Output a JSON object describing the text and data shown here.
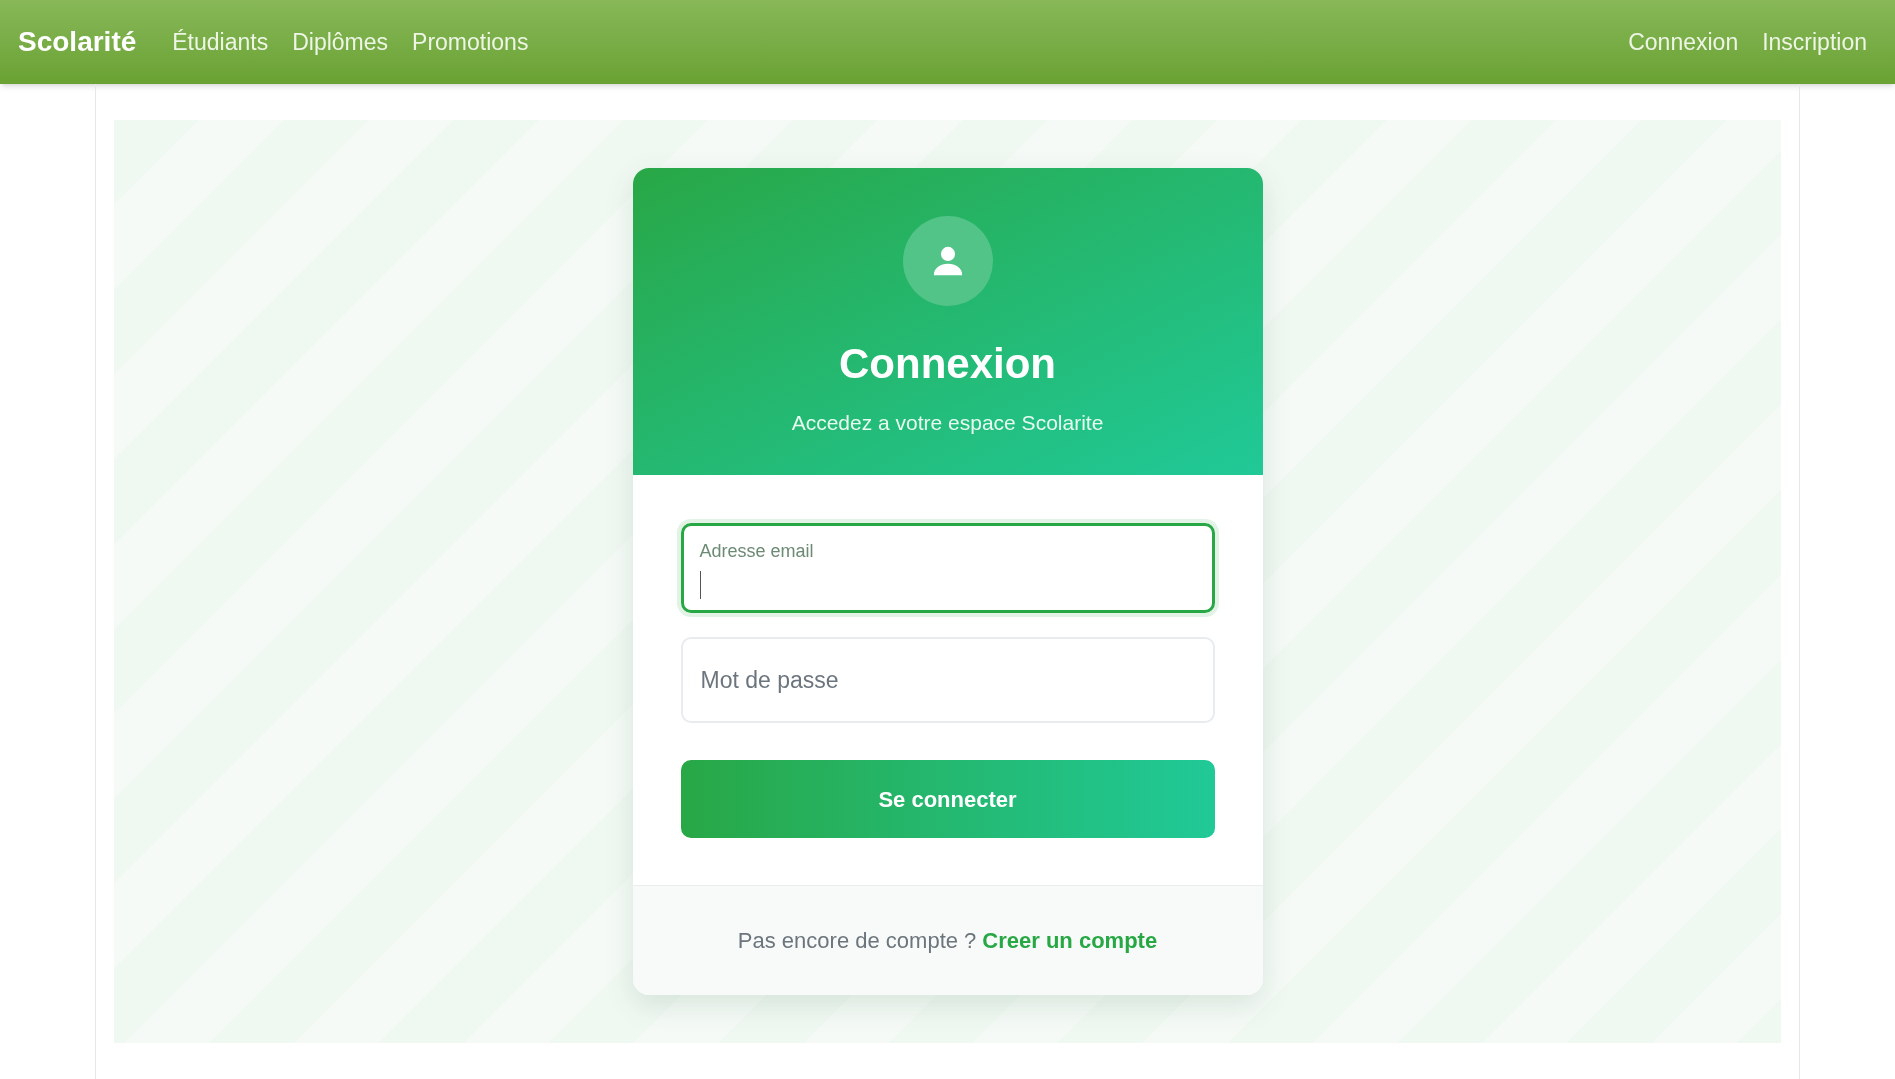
{
  "navbar": {
    "brand": "Scolarité",
    "links": [
      {
        "label": "Étudiants"
      },
      {
        "label": "Diplômes"
      },
      {
        "label": "Promotions"
      }
    ],
    "right_links": [
      {
        "label": "Connexion"
      },
      {
        "label": "Inscription"
      }
    ]
  },
  "login_card": {
    "title": "Connexion",
    "subtitle": "Accedez a votre espace Scolarite",
    "fields": [
      {
        "placeholder": "Adresse email",
        "focused": true
      },
      {
        "placeholder": "Mot de passe",
        "focused": false
      }
    ],
    "submit": "Se connecter",
    "footer": {
      "text": "Pas encore de compte ?",
      "link": "Creer un compte"
    }
  }
}
